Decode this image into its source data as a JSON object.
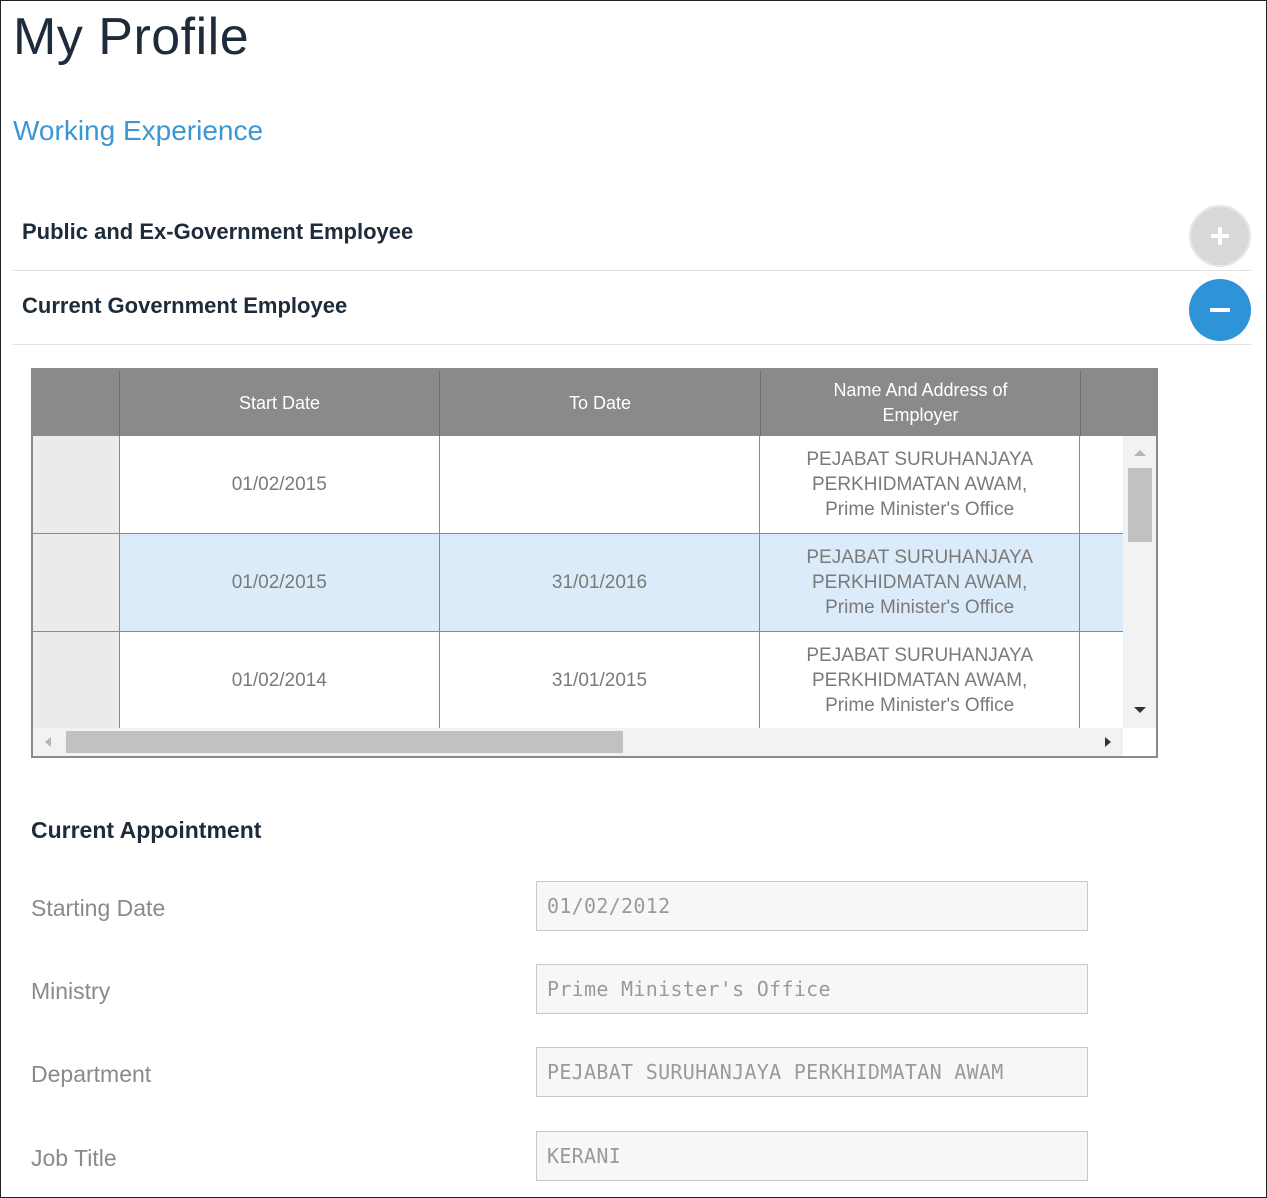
{
  "page": {
    "title": "My Profile"
  },
  "section": {
    "title": "Working Experience"
  },
  "accordion": [
    {
      "label": "Public and Ex-Government Employee",
      "state": "collapsed",
      "icon": "plus-icon",
      "color": "#d9d9d9"
    },
    {
      "label": "Current Government Employee",
      "state": "expanded",
      "icon": "minus-icon",
      "color": "#2f93d8"
    }
  ],
  "grid": {
    "columns": [
      "Start Date",
      "To Date",
      "Name And Address of Employer"
    ],
    "rows": [
      {
        "start": "01/02/2015",
        "to": "",
        "employer": "PEJABAT SURUHANJAYA\nPERKHIDMATAN AWAM,\nPrime Minister's Office",
        "selected": false
      },
      {
        "start": "01/02/2015",
        "to": "31/01/2016",
        "employer": "PEJABAT SURUHANJAYA\nPERKHIDMATAN AWAM,\nPrime Minister's Office",
        "selected": true
      },
      {
        "start": "01/02/2014",
        "to": "31/01/2015",
        "employer": "PEJABAT SURUHANJAYA\nPERKHIDMATAN AWAM,\nPrime Minister's Office",
        "selected": false
      }
    ]
  },
  "appointment": {
    "title": "Current Appointment",
    "fields": [
      {
        "label": "Starting Date",
        "value": "01/02/2012"
      },
      {
        "label": "Ministry",
        "value": "Prime Minister's Office"
      },
      {
        "label": "Department",
        "value": "PEJABAT SURUHANJAYA PERKHIDMATAN AWAM"
      },
      {
        "label": "Job Title",
        "value": "KERANI"
      }
    ]
  },
  "colors": {
    "accent": "#3a97d4",
    "header": "#8a8a8a",
    "selected_row": "#dcebf9"
  }
}
